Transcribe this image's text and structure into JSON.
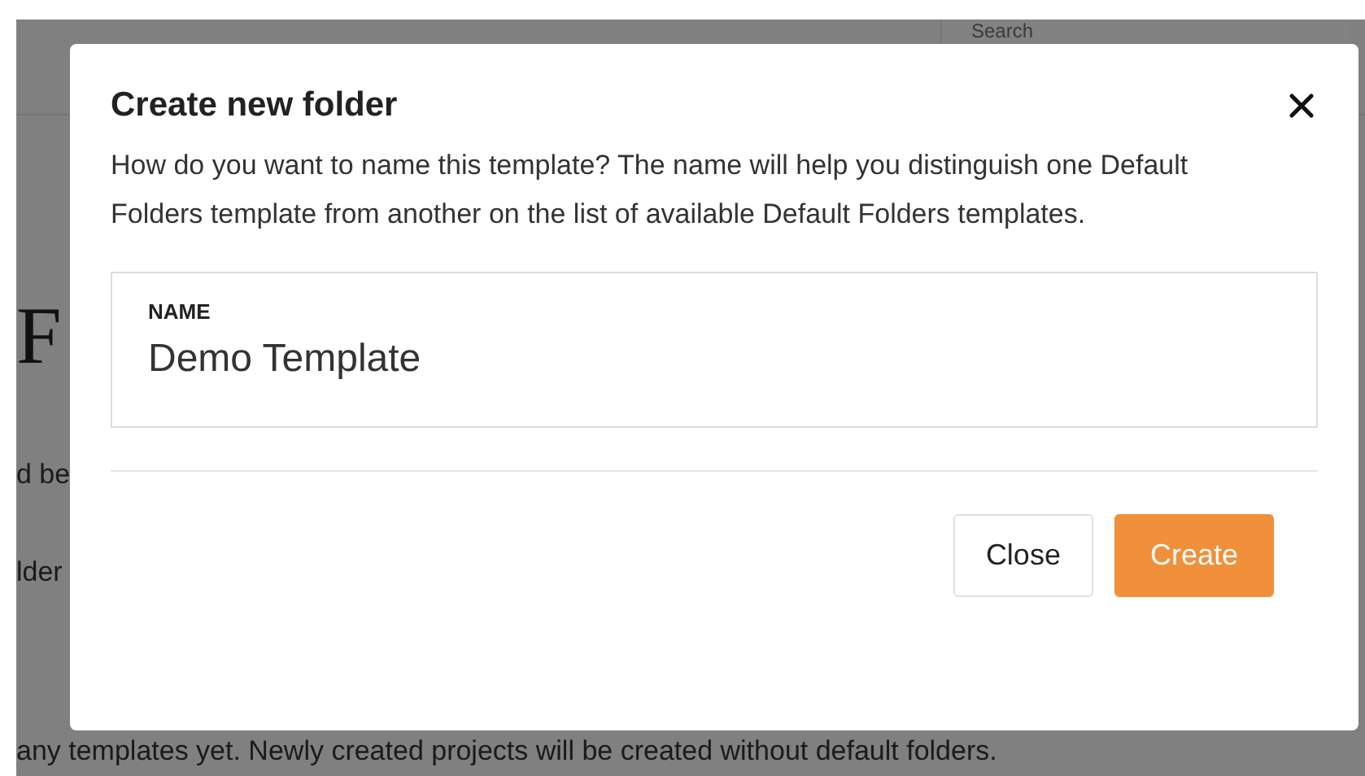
{
  "background": {
    "search": {
      "placeholder": "Search"
    },
    "heading": "F",
    "lines": [
      "d be",
      "lder"
    ],
    "footer": "any templates yet. Newly created projects will be created without default folders."
  },
  "dialog": {
    "title": "Create new folder",
    "description": "How do you want to name this template? The name will help you distinguish one Default Folders template from another on the list of available Default Folders templates.",
    "field": {
      "label": "NAME",
      "value": "Demo Template"
    },
    "buttons": [
      {
        "label": "Close",
        "kind": "secondary"
      },
      {
        "label": "Create",
        "kind": "primary"
      }
    ]
  }
}
